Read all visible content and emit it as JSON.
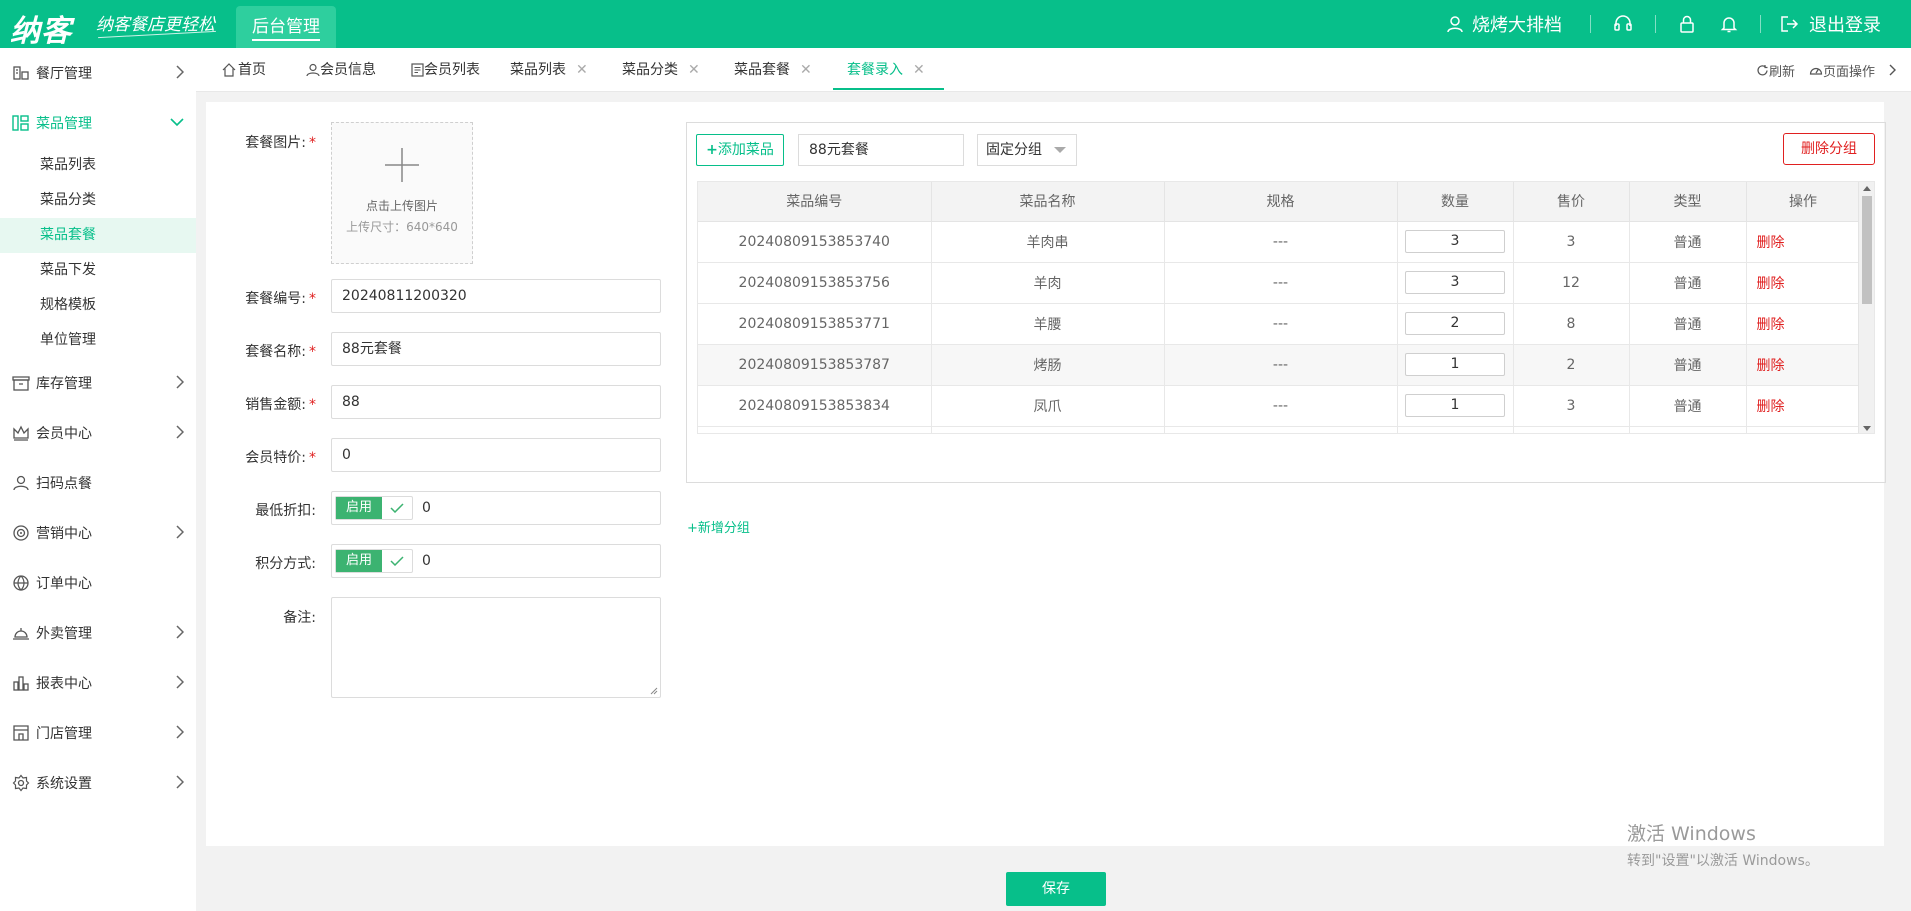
{
  "app": {
    "logo": "纳客",
    "slogan": "纳客餐店更轻松",
    "admin_tab": "后台管理",
    "user_name": "烧烤大排档",
    "logout": "退出登录"
  },
  "sidebar": {
    "items": [
      {
        "label": "餐厅管理",
        "icon": "restaurant-icon"
      },
      {
        "label": "菜品管理",
        "icon": "dish-icon",
        "open": true,
        "children": [
          {
            "label": "菜品列表"
          },
          {
            "label": "菜品分类"
          },
          {
            "label": "菜品套餐",
            "active": true
          },
          {
            "label": "菜品下发"
          },
          {
            "label": "规格模板"
          },
          {
            "label": "单位管理"
          }
        ]
      },
      {
        "label": "库存管理",
        "icon": "inventory-icon"
      },
      {
        "label": "会员中心",
        "icon": "crown-icon"
      },
      {
        "label": "扫码点餐",
        "icon": "user-icon"
      },
      {
        "label": "营销中心",
        "icon": "target-icon"
      },
      {
        "label": "订单中心",
        "icon": "globe-icon"
      },
      {
        "label": "外卖管理",
        "icon": "bell-service-icon"
      },
      {
        "label": "报表中心",
        "icon": "report-icon"
      },
      {
        "label": "门店管理",
        "icon": "store-icon"
      },
      {
        "label": "系统设置",
        "icon": "gear-icon"
      }
    ]
  },
  "tabs": {
    "items": [
      {
        "label": "首页"
      },
      {
        "label": "会员信息"
      },
      {
        "label": "会员列表"
      },
      {
        "label": "菜品列表"
      },
      {
        "label": "菜品分类"
      },
      {
        "label": "菜品套餐"
      },
      {
        "label": "套餐录入",
        "active": true
      }
    ],
    "refresh": "刷新",
    "page_ops": "页面操作"
  },
  "form": {
    "image_label": "套餐图片:",
    "upload_text": "点击上传图片",
    "upload_size": "上传尺寸：640*640",
    "code_label": "套餐编号:",
    "code_value": "20240811200320",
    "name_label": "套餐名称:",
    "name_value": "88元套餐",
    "amount_label": "销售金额:",
    "amount_value": "88",
    "member_price_label": "会员特价:",
    "member_price_value": "0",
    "min_discount_label": "最低折扣:",
    "min_discount_toggle": "启用",
    "min_discount_value": "0",
    "points_label": "积分方式:",
    "points_toggle": "启用",
    "points_value": "0",
    "remark_label": "备注:",
    "required_mark": "*"
  },
  "group": {
    "add_dish": "添加菜品",
    "group_name": "88元套餐",
    "group_type": "固定分组",
    "delete_group": "删除分组",
    "add_group": "+新增分组"
  },
  "table": {
    "columns": [
      "菜品编号",
      "菜品名称",
      "规格",
      "数量",
      "售价",
      "类型",
      "操作"
    ],
    "rows": [
      {
        "code": "20240809153853740",
        "name": "羊肉串",
        "spec": "---",
        "qty": "3",
        "price": "3",
        "type": "普通",
        "op": "删除"
      },
      {
        "code": "20240809153853756",
        "name": "羊肉",
        "spec": "---",
        "qty": "3",
        "price": "12",
        "type": "普通",
        "op": "删除"
      },
      {
        "code": "20240809153853771",
        "name": "羊腰",
        "spec": "---",
        "qty": "2",
        "price": "8",
        "type": "普通",
        "op": "删除"
      },
      {
        "code": "20240809153853787",
        "name": "烤肠",
        "spec": "---",
        "qty": "1",
        "price": "2",
        "type": "普通",
        "op": "删除"
      },
      {
        "code": "20240809153853834",
        "name": "凤爪",
        "spec": "---",
        "qty": "1",
        "price": "3",
        "type": "普通",
        "op": "删除"
      }
    ]
  },
  "footer": {
    "save": "保存"
  },
  "watermark": {
    "line1": "激活 Windows",
    "line2": "转到\"设置\"以激活 Windows。"
  },
  "colors": {
    "brand": "#07bf8a",
    "danger": "#e02020"
  }
}
